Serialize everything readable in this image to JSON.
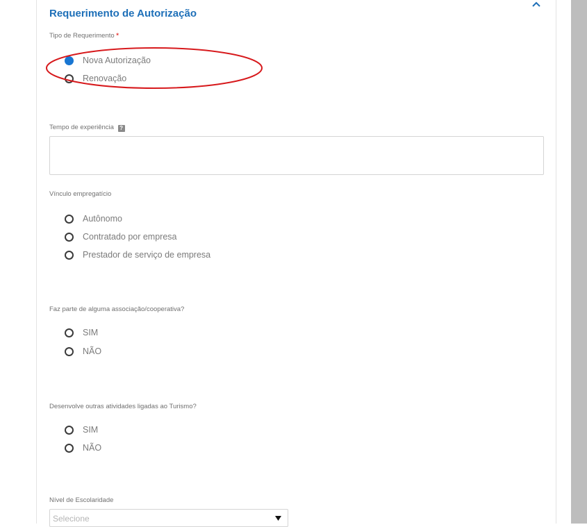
{
  "section": {
    "title": "Requerimento de Autorização"
  },
  "tipo_requerimento": {
    "label": "Tipo de Requerimento",
    "required_mark": "*",
    "options": [
      "Nova Autorização",
      "Renovação"
    ],
    "selected": "Nova Autorização"
  },
  "tempo_experiencia": {
    "label": "Tempo de experiência",
    "help_glyph": "?",
    "value": ""
  },
  "vinculo": {
    "label": "Vínculo empregatício",
    "options": [
      "Autônomo",
      "Contratado por empresa",
      "Prestador de serviço de empresa"
    ]
  },
  "associacao": {
    "label": "Faz parte de alguma associação/cooperativa?",
    "options": [
      "SIM",
      "NÃO"
    ]
  },
  "turismo": {
    "label": "Desenvolve outras atividades ligadas ao Turismo?",
    "options": [
      "SIM",
      "NÃO"
    ]
  },
  "escolaridade": {
    "label": "Nível de Escolaridade",
    "placeholder": "Selecione"
  },
  "colors": {
    "title": "#1d6fb8",
    "radio_checked": "#1976d2",
    "required": "#e53935",
    "annotation": "#d7191c",
    "scrollbar": "#bdbdbd"
  },
  "icons": {
    "collapse": "chevron-up-icon",
    "help": "help-icon",
    "dropdown": "caret-down-icon"
  }
}
